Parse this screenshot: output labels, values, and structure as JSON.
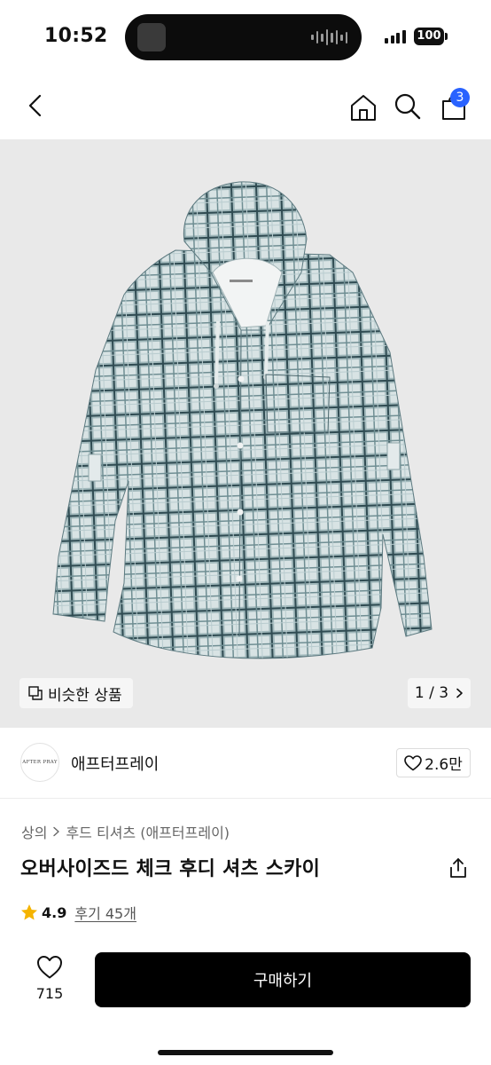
{
  "status_bar": {
    "time": "10:52",
    "battery": "100"
  },
  "nav": {
    "cart_count": "3"
  },
  "gallery": {
    "similar_label": "비슷한 상품",
    "pager": "1 / 3"
  },
  "brand": {
    "name": "애프터프레이",
    "logo_text": "AFTER PRAY",
    "likes": "2.6만"
  },
  "breadcrumb": {
    "category": "상의",
    "subcategory": "후드 티셔츠 (애프터프레이)"
  },
  "product": {
    "title": "오버사이즈드 체크 후디 셔츠 스카이"
  },
  "rating": {
    "score": "4.9",
    "review_label": "후기 45개"
  },
  "bottom_bar": {
    "wish_count": "715",
    "buy_label": "구매하기"
  },
  "colors": {
    "accent_badge": "#2962ff",
    "buy_button": "#000000",
    "star": "#f5b400"
  }
}
